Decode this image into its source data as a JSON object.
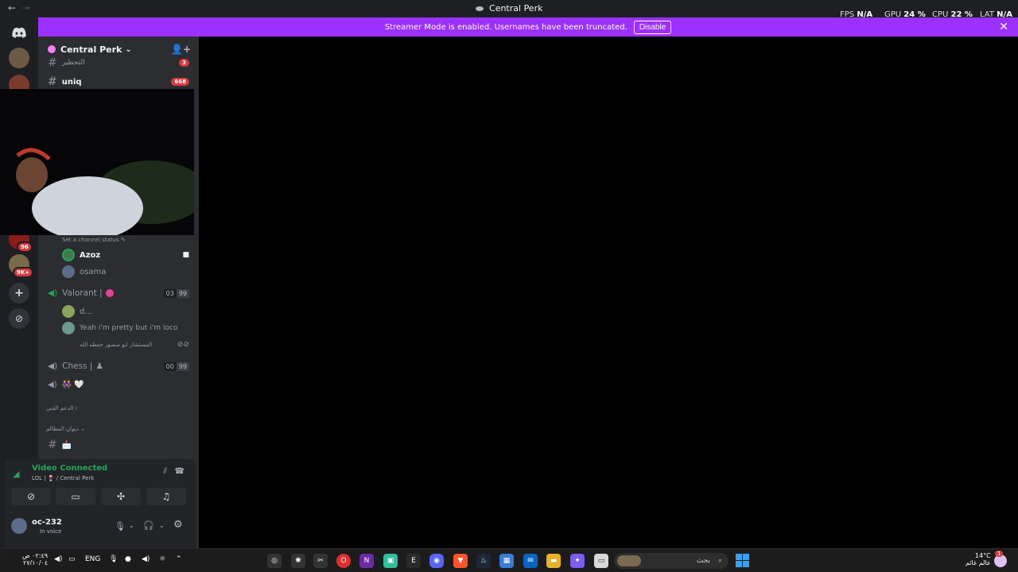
{
  "titlebar": {
    "back": "←",
    "forward": "→",
    "title": "Central Perk"
  },
  "overlay": {
    "fps_label": "FPS",
    "fps": "N/A",
    "gpu_label": "GPU",
    "gpu": "24 %",
    "cpu_label": "CPU",
    "cpu": "22 %",
    "lat_label": "LAT",
    "lat": "N/A"
  },
  "banner": {
    "text": "Streamer Mode is enabled. Usernames have been truncated.",
    "button": "Disable",
    "close": "✕"
  },
  "guilds": {
    "badge1": "96",
    "badge2": "9K+",
    "add": "+",
    "explore": "⊘"
  },
  "server": {
    "name": "Central Perk",
    "chevron": "⌄"
  },
  "channels": {
    "ch1": {
      "name": "التحظير",
      "badge": "3"
    },
    "ch2": {
      "name": "uniq",
      "badge": "668"
    },
    "set_status": "Set a channel status ✎",
    "voice1": {
      "users": [
        "Azoz",
        "osama"
      ]
    },
    "voice2": {
      "name": "Valorant |",
      "count_a": "03",
      "count_b": "99",
      "users": [
        "d...",
        "Yeah i'm pretty but i'm loco",
        "المستشار ابو منصور حفظه الله"
      ]
    },
    "voice3": {
      "name": "Chess |",
      "count_a": "00",
      "count_b": "99"
    },
    "voice4": {
      "name": "👭 🤍"
    },
    "cat1": "الدعم الفني ›",
    "cat2": "ديوان المظالم ⌄",
    "ch3": {
      "name": "📩"
    }
  },
  "voice_panel": {
    "status": "Video Connected",
    "location": "LOL | 🍷 / Central Perk"
  },
  "user": {
    "name": "oc-232",
    "status": "In voice"
  },
  "taskbar": {
    "lang": "ENG",
    "time": "٠٢:٤٩ ص",
    "date": "٢٧/١٠/٠٤",
    "search_placeholder": "بحث",
    "temp": "14°C",
    "weather": "عالم غائم",
    "notif": "1"
  },
  "colors": {
    "accent": "#9b30ff",
    "discord": "#5865f2",
    "green": "#23a55a",
    "red": "#da373c"
  }
}
